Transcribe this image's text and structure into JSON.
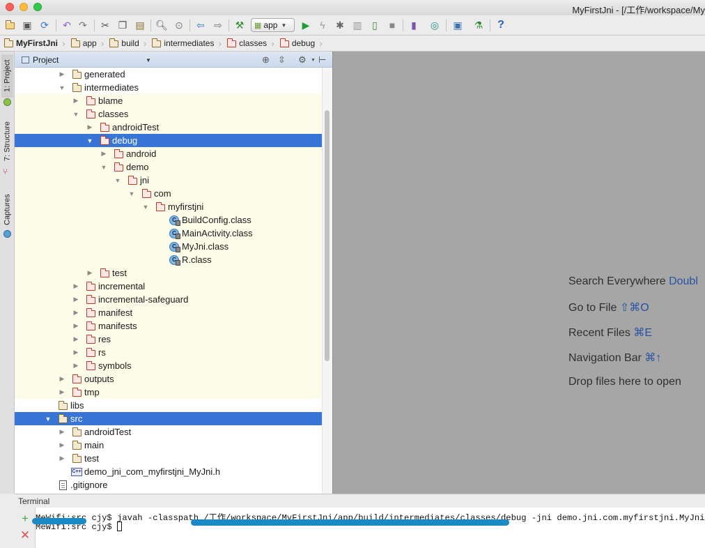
{
  "window": {
    "title": "MyFirstJni - [/工作/workspace/My"
  },
  "toolbar": {
    "run_config": "app"
  },
  "breadcrumb": [
    {
      "label": "MyFirstJni"
    },
    {
      "label": "app"
    },
    {
      "label": "build"
    },
    {
      "label": "intermediates"
    },
    {
      "label": "classes"
    },
    {
      "label": "debug"
    }
  ],
  "side_tabs": {
    "project": "1: Project",
    "structure": "7: Structure",
    "captures": "Captures"
  },
  "project_panel": {
    "title": "Project"
  },
  "tree": [
    {
      "label": "generated",
      "depth": 0,
      "expanded": false,
      "icon": "folder",
      "highlight": false
    },
    {
      "label": "intermediates",
      "depth": 0,
      "expanded": true,
      "icon": "folder",
      "highlight": false
    },
    {
      "label": "blame",
      "depth": 1,
      "expanded": false,
      "icon": "folder-excluded",
      "highlight": true
    },
    {
      "label": "classes",
      "depth": 1,
      "expanded": true,
      "icon": "folder-excluded",
      "highlight": true
    },
    {
      "label": "androidTest",
      "depth": 2,
      "expanded": false,
      "icon": "folder-excluded",
      "highlight": true
    },
    {
      "label": "debug",
      "depth": 2,
      "expanded": true,
      "icon": "folder-excluded",
      "selected": true
    },
    {
      "label": "android",
      "depth": 3,
      "expanded": false,
      "icon": "folder-excluded",
      "highlight": true
    },
    {
      "label": "demo",
      "depth": 3,
      "expanded": true,
      "icon": "folder-excluded",
      "highlight": true
    },
    {
      "label": "jni",
      "depth": 4,
      "expanded": true,
      "icon": "folder-excluded",
      "highlight": true
    },
    {
      "label": "com",
      "depth": 5,
      "expanded": true,
      "icon": "folder-excluded",
      "highlight": true
    },
    {
      "label": "myfirstjni",
      "depth": 6,
      "expanded": true,
      "icon": "folder-excluded",
      "highlight": true
    },
    {
      "label": "BuildConfig.class",
      "depth": 7,
      "icon": "class-file",
      "highlight": true
    },
    {
      "label": "MainActivity.class",
      "depth": 7,
      "icon": "class-file",
      "highlight": true
    },
    {
      "label": "MyJni.class",
      "depth": 7,
      "icon": "class-file",
      "highlight": true
    },
    {
      "label": "R.class",
      "depth": 7,
      "icon": "class-file",
      "highlight": true
    },
    {
      "label": "test",
      "depth": 2,
      "expanded": false,
      "icon": "folder-excluded",
      "highlight": true
    },
    {
      "label": "incremental",
      "depth": 1,
      "expanded": false,
      "icon": "folder-excluded",
      "highlight": true
    },
    {
      "label": "incremental-safeguard",
      "depth": 1,
      "expanded": false,
      "icon": "folder-excluded",
      "highlight": true
    },
    {
      "label": "manifest",
      "depth": 1,
      "expanded": false,
      "icon": "folder-excluded",
      "highlight": true
    },
    {
      "label": "manifests",
      "depth": 1,
      "expanded": false,
      "icon": "folder-excluded",
      "highlight": true
    },
    {
      "label": "res",
      "depth": 1,
      "expanded": false,
      "icon": "folder-excluded",
      "highlight": true
    },
    {
      "label": "rs",
      "depth": 1,
      "expanded": false,
      "icon": "folder-excluded",
      "highlight": true
    },
    {
      "label": "symbols",
      "depth": 1,
      "expanded": false,
      "icon": "folder-excluded",
      "highlight": true
    },
    {
      "label": "outputs",
      "depth": 0,
      "expanded": false,
      "icon": "folder-excluded",
      "highlight": true
    },
    {
      "label": "tmp",
      "depth": 0,
      "expanded": false,
      "icon": "folder-excluded",
      "highlight": true
    },
    {
      "label": "libs",
      "depth": -1,
      "icon": "folder",
      "highlight": false
    },
    {
      "label": "src",
      "depth": -1,
      "expanded": true,
      "icon": "folder",
      "selected": true
    },
    {
      "label": "androidTest",
      "depth": 0,
      "expanded": false,
      "icon": "folder",
      "highlight": false
    },
    {
      "label": "main",
      "depth": 0,
      "expanded": false,
      "icon": "folder",
      "highlight": false
    },
    {
      "label": "test",
      "depth": 0,
      "expanded": false,
      "icon": "folder",
      "highlight": false
    },
    {
      "label": "demo_jni_com_myfirstjni_MyJni.h",
      "depth": 0,
      "icon": "header-file",
      "highlight": false
    },
    {
      "label": ".gitignore",
      "depth": -1,
      "icon": "text-file",
      "highlight": false
    }
  ],
  "editor_hints": [
    {
      "text": "Search Everywhere ",
      "key": "Doubl"
    },
    {
      "text": "Go to File ",
      "key": "⇧⌘O"
    },
    {
      "text": "Recent Files ",
      "key": "⌘E"
    },
    {
      "text": "Navigation Bar ",
      "key": "⌘↑"
    },
    {
      "text": "Drop files here to open",
      "key": ""
    }
  ],
  "terminal": {
    "label": "Terminal",
    "lines": [
      "MeWifi:src cjy$ javah -classpath /工作/workspace/MyFirstJni/app/build/intermediates/classes/debug -jni demo.jni.com.myfirstjni.MyJni",
      "MeWifi:src cjy$ "
    ]
  },
  "colors": {
    "selection": "#3875d7",
    "excluded_folder": "#c0392b",
    "annotation": "#1a8ac7"
  }
}
